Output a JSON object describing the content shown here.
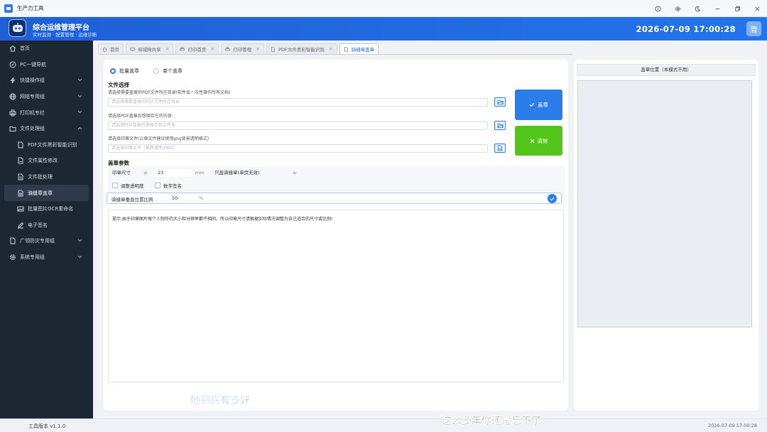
{
  "window": {
    "title": "生产力工具"
  },
  "header": {
    "title": "综合运维管理平台",
    "subtitle": "实时监测 · 配置管理 · 运维诊断",
    "datetime": "2026-07-09 17:00:28",
    "avatar_text": "管"
  },
  "sidebar": {
    "items": [
      {
        "label": "首页"
      },
      {
        "label": "PC一键导航"
      },
      {
        "label": "快捷操作组"
      },
      {
        "label": "网络专用组"
      },
      {
        "label": "打印机专栏"
      },
      {
        "label": "文件处理组"
      },
      {
        "label": "PDF文件黑彩智能识别"
      },
      {
        "label": "文件属性修改"
      },
      {
        "label": "文件批处理"
      },
      {
        "label": "骑缝章盖章"
      },
      {
        "label": "批量图片OCR重命名"
      },
      {
        "label": "电子签名"
      },
      {
        "label": "广领防灾专用组"
      },
      {
        "label": "系统专用组"
      }
    ]
  },
  "tabs": [
    {
      "label": "首页"
    },
    {
      "label": "局域网共享"
    },
    {
      "label": "打印首页"
    },
    {
      "label": "打印管理"
    },
    {
      "label": "PDF文件黑彩智能识别"
    },
    {
      "label": "骑缝章盖章"
    }
  ],
  "mode": {
    "batch": "批量盖章",
    "single": "单个盖章"
  },
  "file_select": {
    "section_title": "文件选择",
    "pdf_dir_label": "请选择需要盖章的PDF文件所在目录(软件会一次性操作所有文档)",
    "pdf_dir_placeholder": "请选择需要盖章的PDF文件所在目录",
    "save_dir_label": "请选择PDF盖章后想保存在的内容",
    "save_dir_placeholder": "请选择PDF盖章后想保存到文件夹",
    "stamp_label": "请选择印章文件(公章文件建议使用png背景透明格式)",
    "stamp_placeholder": "请选择印章文件（推荐透明 PNG）"
  },
  "actions": {
    "stamp": "盖章",
    "clear": "清除"
  },
  "params": {
    "section_title": "盖章参数",
    "size_select": "印章尺寸",
    "size_value": "23",
    "size_unit": "mm",
    "mode_select": "只盖骑缝章(单页无效)",
    "transparency": "调整透明度",
    "digital_sign": "数字签名",
    "ratio_label": "骑缝章垂直位置比例",
    "ratio_value": "50",
    "ratio_unit": "%"
  },
  "tip": "提示:由于印章图片每个人制作的大小和分辨率都不相同，所以印章尺寸请根据实际情况调整为自己适合的尺寸或比例!",
  "preview": {
    "title": "盖章位置（本模式不用）"
  },
  "footer": {
    "version": "工具版本 v1.1.0",
    "datetime": "2026-07-09 17:00:28"
  },
  "captions": {
    "line1": "他到底有多好",
    "line2": "这么多年你还是忘不了"
  },
  "colors": {
    "primary": "#2b7de9",
    "success": "#52c41a",
    "sidebar_bg": "#1d2633",
    "header_bg": "#2474ea"
  }
}
